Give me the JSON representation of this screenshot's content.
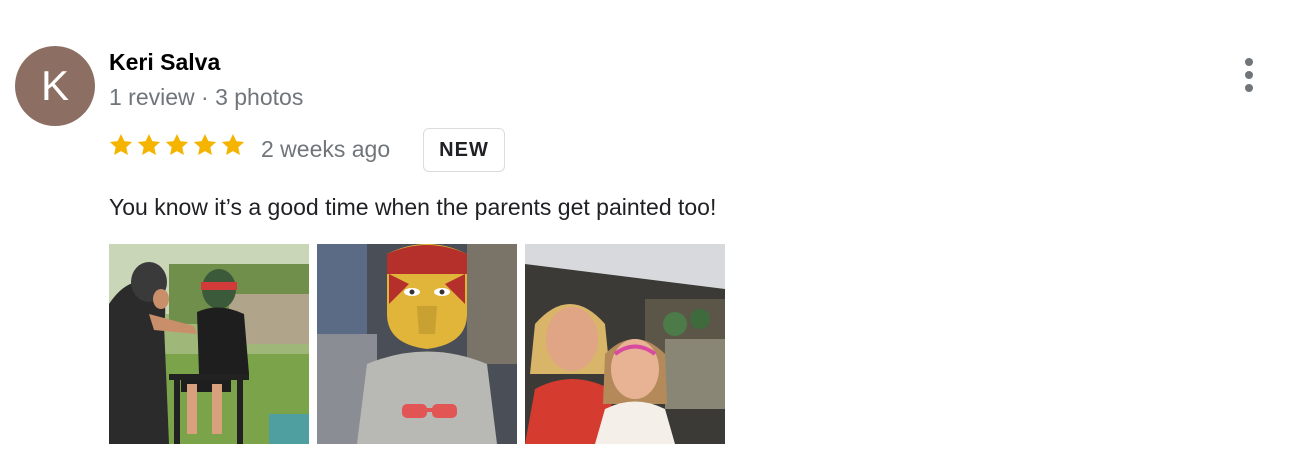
{
  "review": {
    "avatar_letter": "K",
    "avatar_color": "#8d6e63",
    "reviewer_name": "Keri Salva",
    "reviewer_meta": "1 review · 3 photos",
    "rating": 5,
    "rating_max": 5,
    "star_color": "#f4b400",
    "time_ago": "2 weeks ago",
    "badge": "NEW",
    "text": "You know it’s a good time when the parents get painted too!",
    "more_icon": "more-vert-icon",
    "photos": [
      {
        "subject": "face-painting-child-outdoors"
      },
      {
        "subject": "child-with-iron-man-face-paint"
      },
      {
        "subject": "two-women-with-face-paint"
      }
    ]
  }
}
